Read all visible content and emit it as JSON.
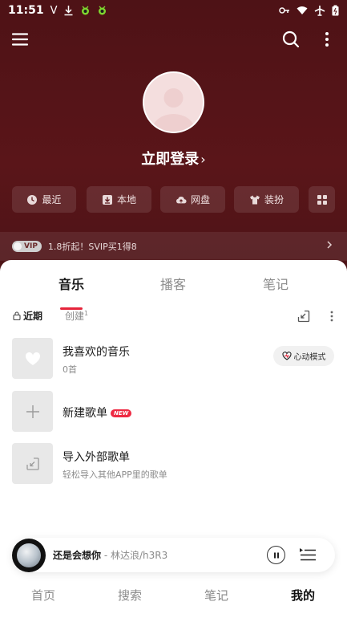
{
  "status_bar": {
    "time": "11:51",
    "left_glyph": "V"
  },
  "profile": {
    "login_label": "立即登录",
    "login_arrow": "›"
  },
  "quick_actions": [
    {
      "label": "最近",
      "icon": "clock-icon"
    },
    {
      "label": "本地",
      "icon": "download-icon"
    },
    {
      "label": "网盘",
      "icon": "cloud-icon"
    },
    {
      "label": "装扮",
      "icon": "shirt-icon"
    }
  ],
  "vip": {
    "badge": "VIP",
    "text": "1.8折起！SVIP买1得8"
  },
  "tabs": [
    {
      "label": "音乐",
      "active": true
    },
    {
      "label": "播客",
      "active": false
    },
    {
      "label": "笔记",
      "active": false
    }
  ],
  "subtabs": {
    "recent": "近期",
    "create": "创建",
    "create_count": "1"
  },
  "playlists": [
    {
      "title": "我喜欢的音乐",
      "subtitle": "0首",
      "icon": "heart-icon"
    },
    {
      "title": "新建歌单",
      "badge": "NEW",
      "icon": "plus-icon"
    },
    {
      "title": "导入外部歌单",
      "subtitle": "轻松导入其他APP里的歌单",
      "icon": "import-icon"
    }
  ],
  "heartbeat_label": "心动模式",
  "player": {
    "song": "还是会想你",
    "separator": " - ",
    "artist": "林达浪/h3R3"
  },
  "bottom_nav": [
    {
      "label": "首页",
      "active": false
    },
    {
      "label": "搜索",
      "active": false
    },
    {
      "label": "笔记",
      "active": false
    },
    {
      "label": "我的",
      "active": true
    }
  ],
  "colors": {
    "hero_bg": "#541418",
    "accent": "#e6243b"
  }
}
